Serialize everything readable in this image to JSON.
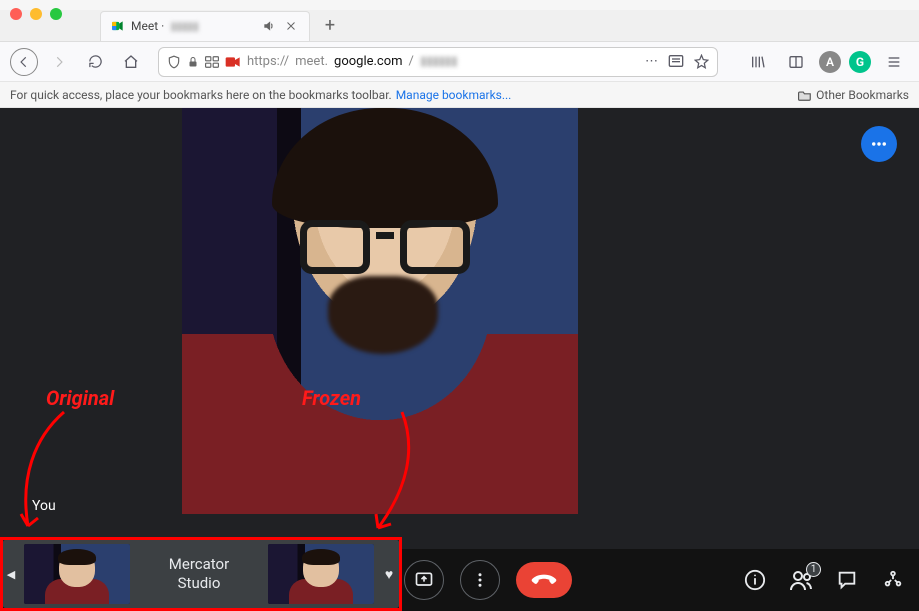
{
  "browser": {
    "tab": {
      "title_prefix": "Meet ·",
      "title_obscured": "▮▮▮▮▮"
    },
    "url": {
      "scheme": "https://",
      "host_prefix": "meet.",
      "host_domain": "google.com",
      "path_slash": "/",
      "path_obscured": "▮▮▮▮▮▮"
    },
    "bookmarks_hint": "For quick access, place your bookmarks here on the bookmarks toolbar.",
    "bookmarks_link": "Manage bookmarks...",
    "other_bookmarks": "Other Bookmarks"
  },
  "meet": {
    "you_label": "You",
    "participant_count": "1",
    "studio": {
      "title_line1": "Mercator",
      "title_line2": "Studio"
    }
  },
  "annotations": {
    "original": "Original",
    "frozen": "Frozen"
  }
}
